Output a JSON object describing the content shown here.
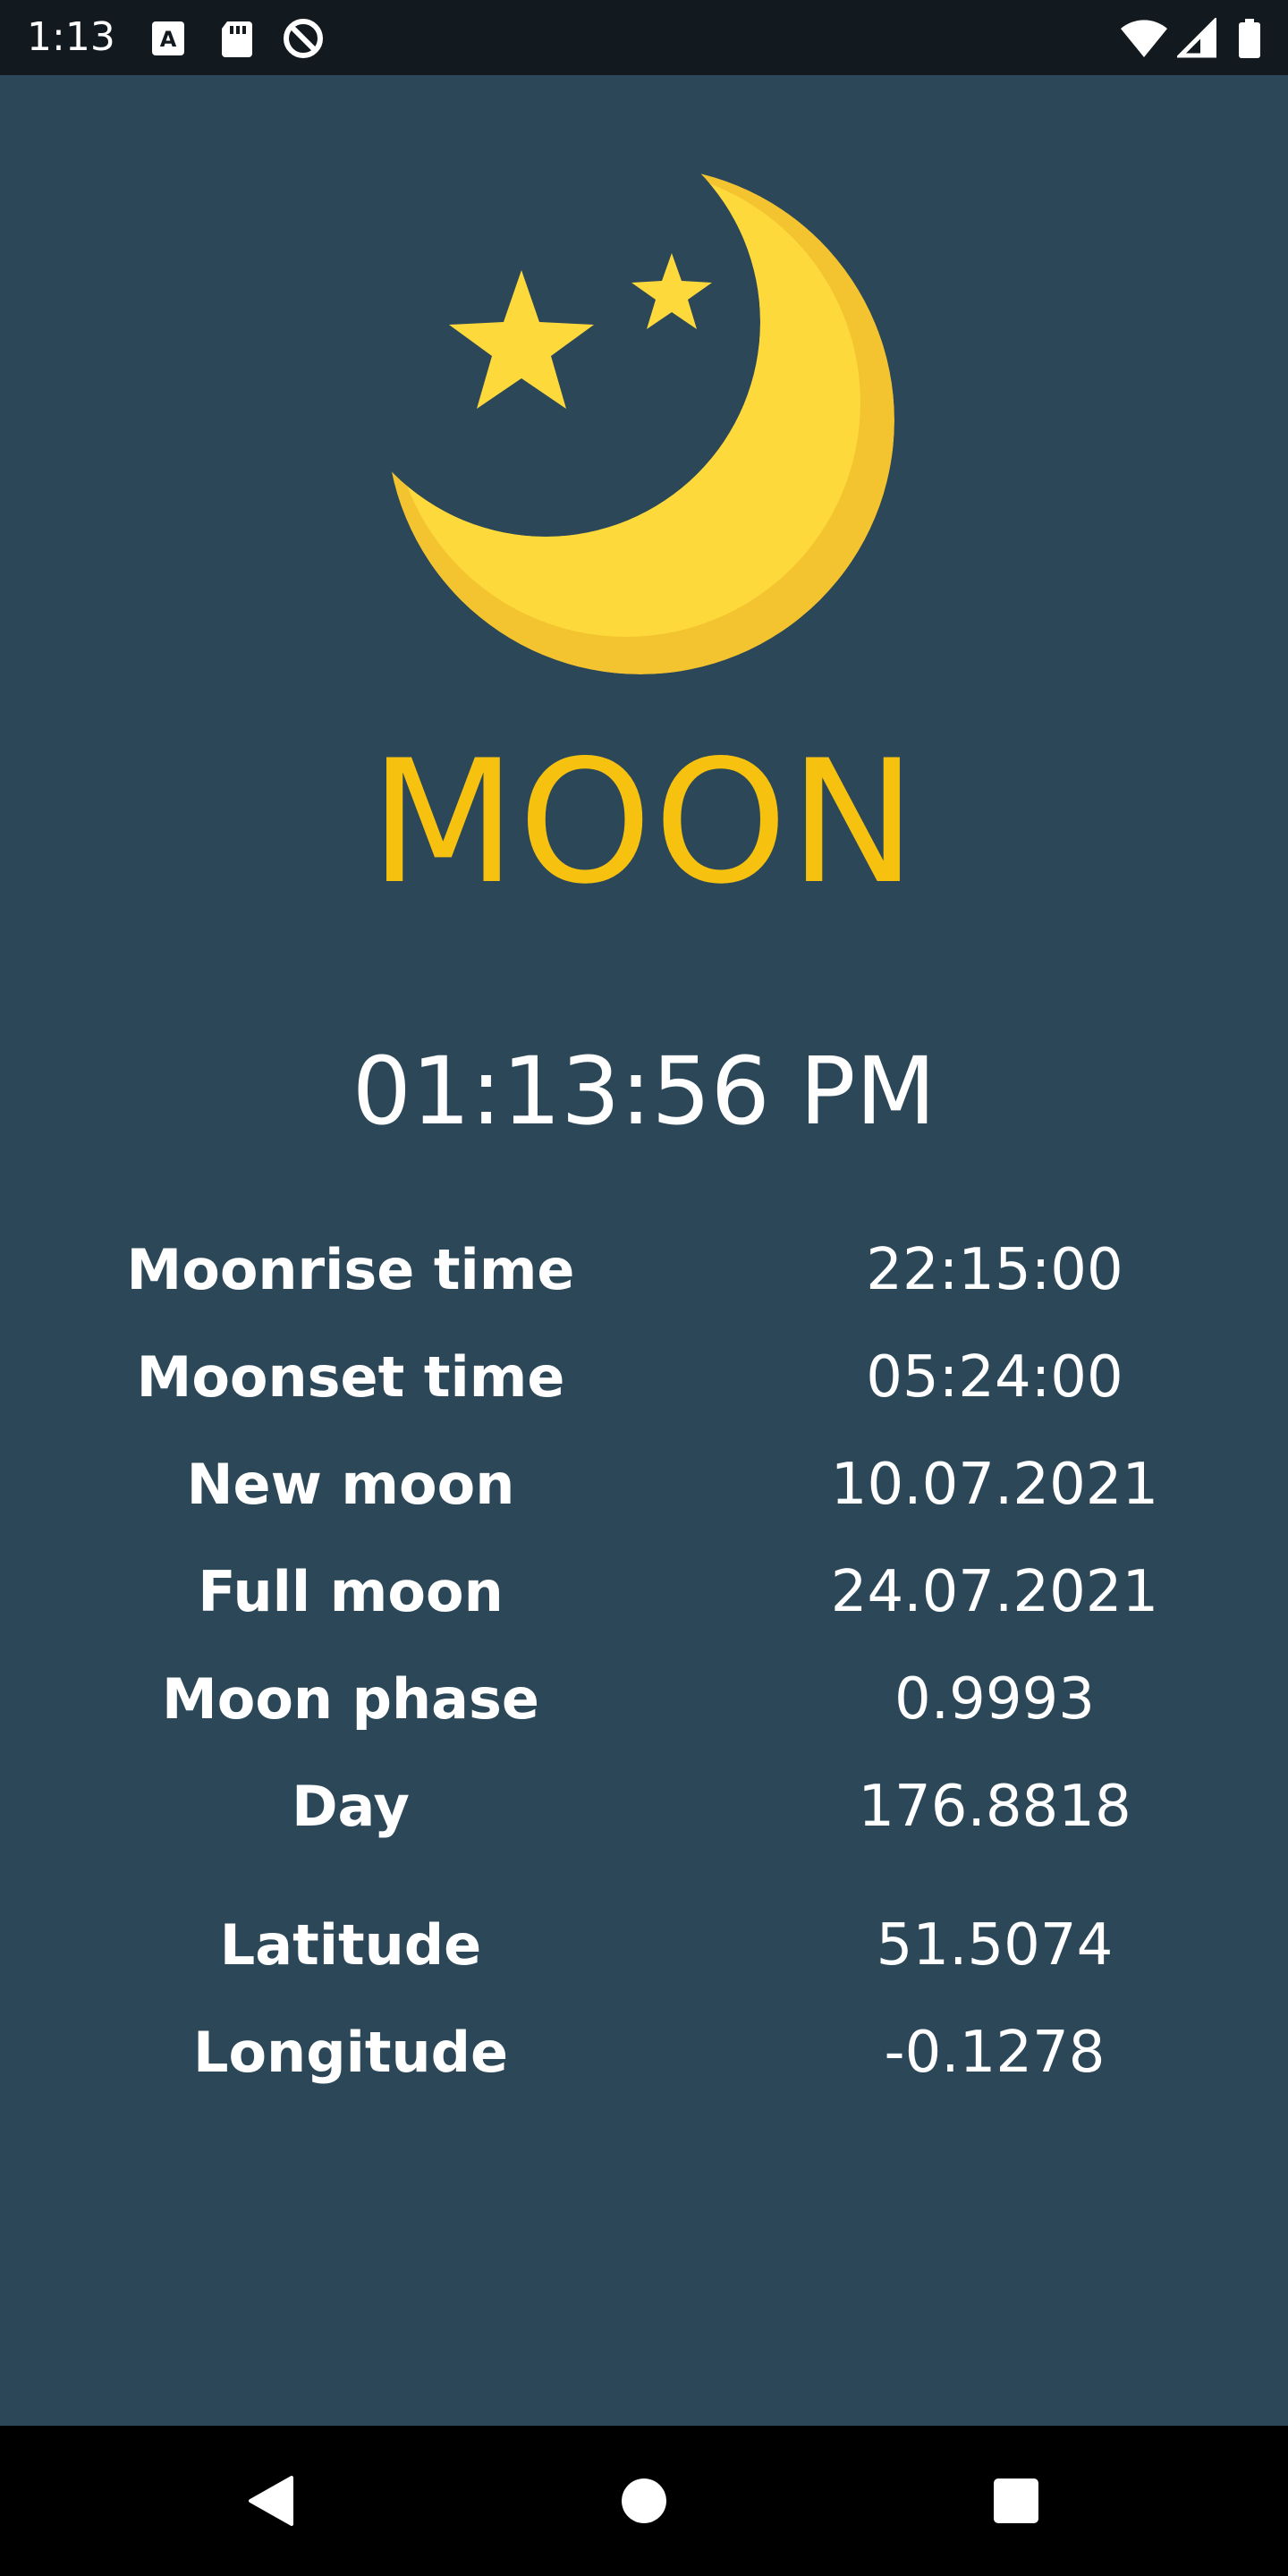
{
  "status_bar": {
    "time": "1:13",
    "icons": [
      "text-a-notification-icon",
      "sd-card-icon",
      "data-saver-icon",
      "wifi-icon",
      "signal-icon",
      "battery-icon"
    ]
  },
  "app": {
    "title": "MOON",
    "clock": "01:13:56 PM",
    "accent_color": "#f6c20f",
    "background_color": "#2c4858"
  },
  "info": [
    {
      "label": "Moonrise time",
      "value": "22:15:00"
    },
    {
      "label": "Moonset time",
      "value": "05:24:00"
    },
    {
      "label": "New moon",
      "value": "10.07.2021"
    },
    {
      "label": "Full moon",
      "value": "24.07.2021"
    },
    {
      "label": "Moon phase",
      "value": "0.9993"
    },
    {
      "label": "Day",
      "value": "176.8818"
    },
    {
      "label": "Latitude",
      "value": "51.5074"
    },
    {
      "label": "Longitude",
      "value": "-0.1278"
    }
  ],
  "nav_bar": {
    "buttons": [
      "back-icon",
      "home-icon",
      "recents-icon"
    ]
  }
}
